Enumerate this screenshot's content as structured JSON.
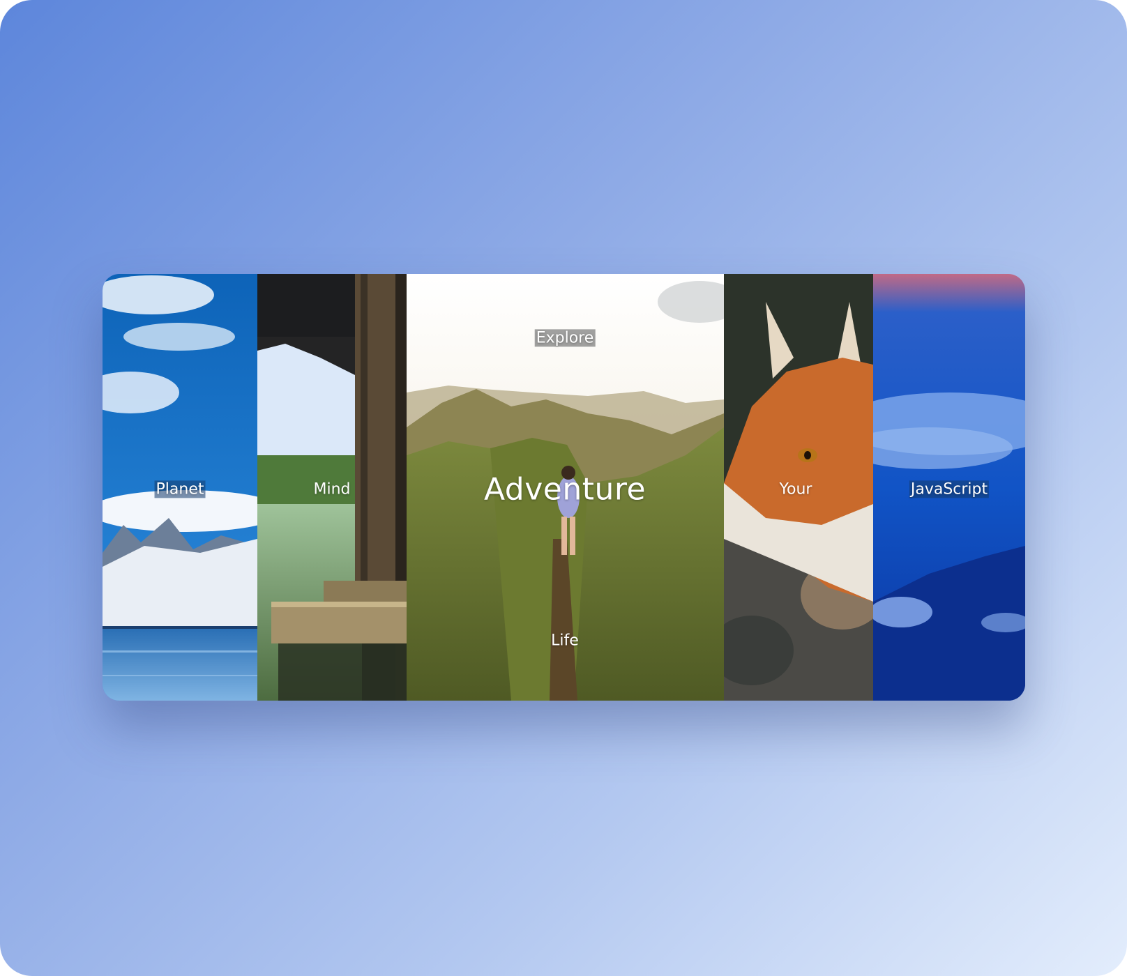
{
  "gallery": {
    "panels": [
      {
        "id": "planet",
        "label": "Planet"
      },
      {
        "id": "mind",
        "label": "Mind"
      },
      {
        "id": "adventure",
        "label": "Adventure",
        "top_word": "Explore",
        "bottom_word": "Life"
      },
      {
        "id": "your",
        "label": "Your"
      },
      {
        "id": "javascript",
        "label": "JavaScript"
      }
    ]
  },
  "colors": {
    "background_start": "#5d86db",
    "background_end": "#e3edfc",
    "label_text": "#ffffff"
  }
}
